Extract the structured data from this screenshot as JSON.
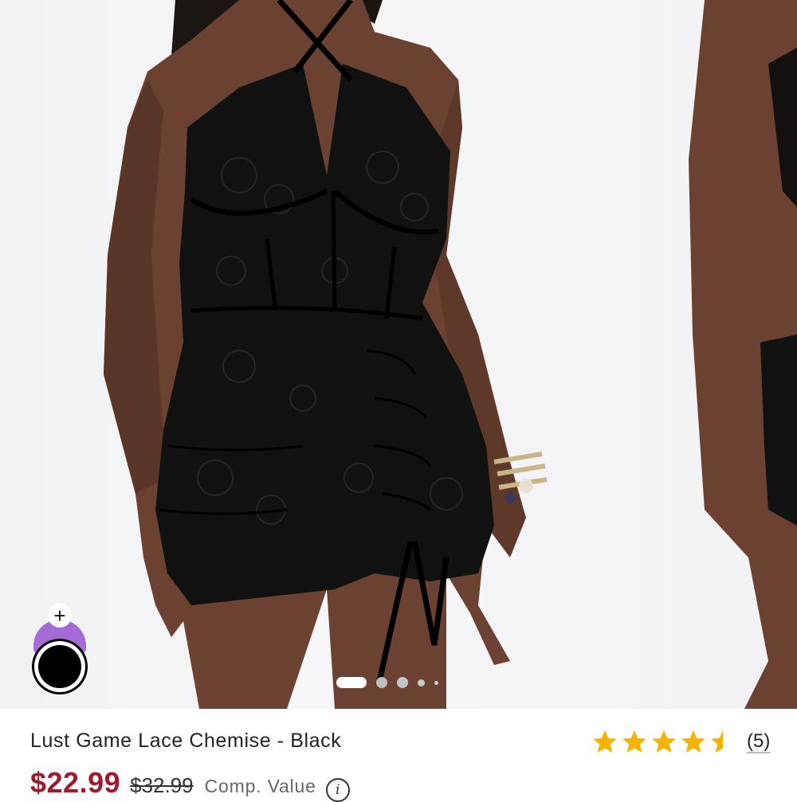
{
  "product": {
    "title": "Lust Game Lace Chemise - Black",
    "price": "$22.99",
    "original_price": "$32.99",
    "comp_value_label": "Comp. Value",
    "info_icon": "i",
    "rating": 4.5,
    "reviews_count": "(5)"
  },
  "gallery": {
    "current_index": 1,
    "total_dots": 5,
    "main_image_alt": "product-photo-front",
    "next_image_alt": "product-photo-side"
  },
  "swatch": {
    "add_symbol": "+",
    "selected_color": "#000000",
    "tab_color": "#a66ad8"
  },
  "colors": {
    "price": "#9b1c2c",
    "star": "#f5b301"
  },
  "icons": {
    "star": "star-icon",
    "half_star": "half-star-icon",
    "info": "info-icon",
    "add": "plus-icon"
  }
}
